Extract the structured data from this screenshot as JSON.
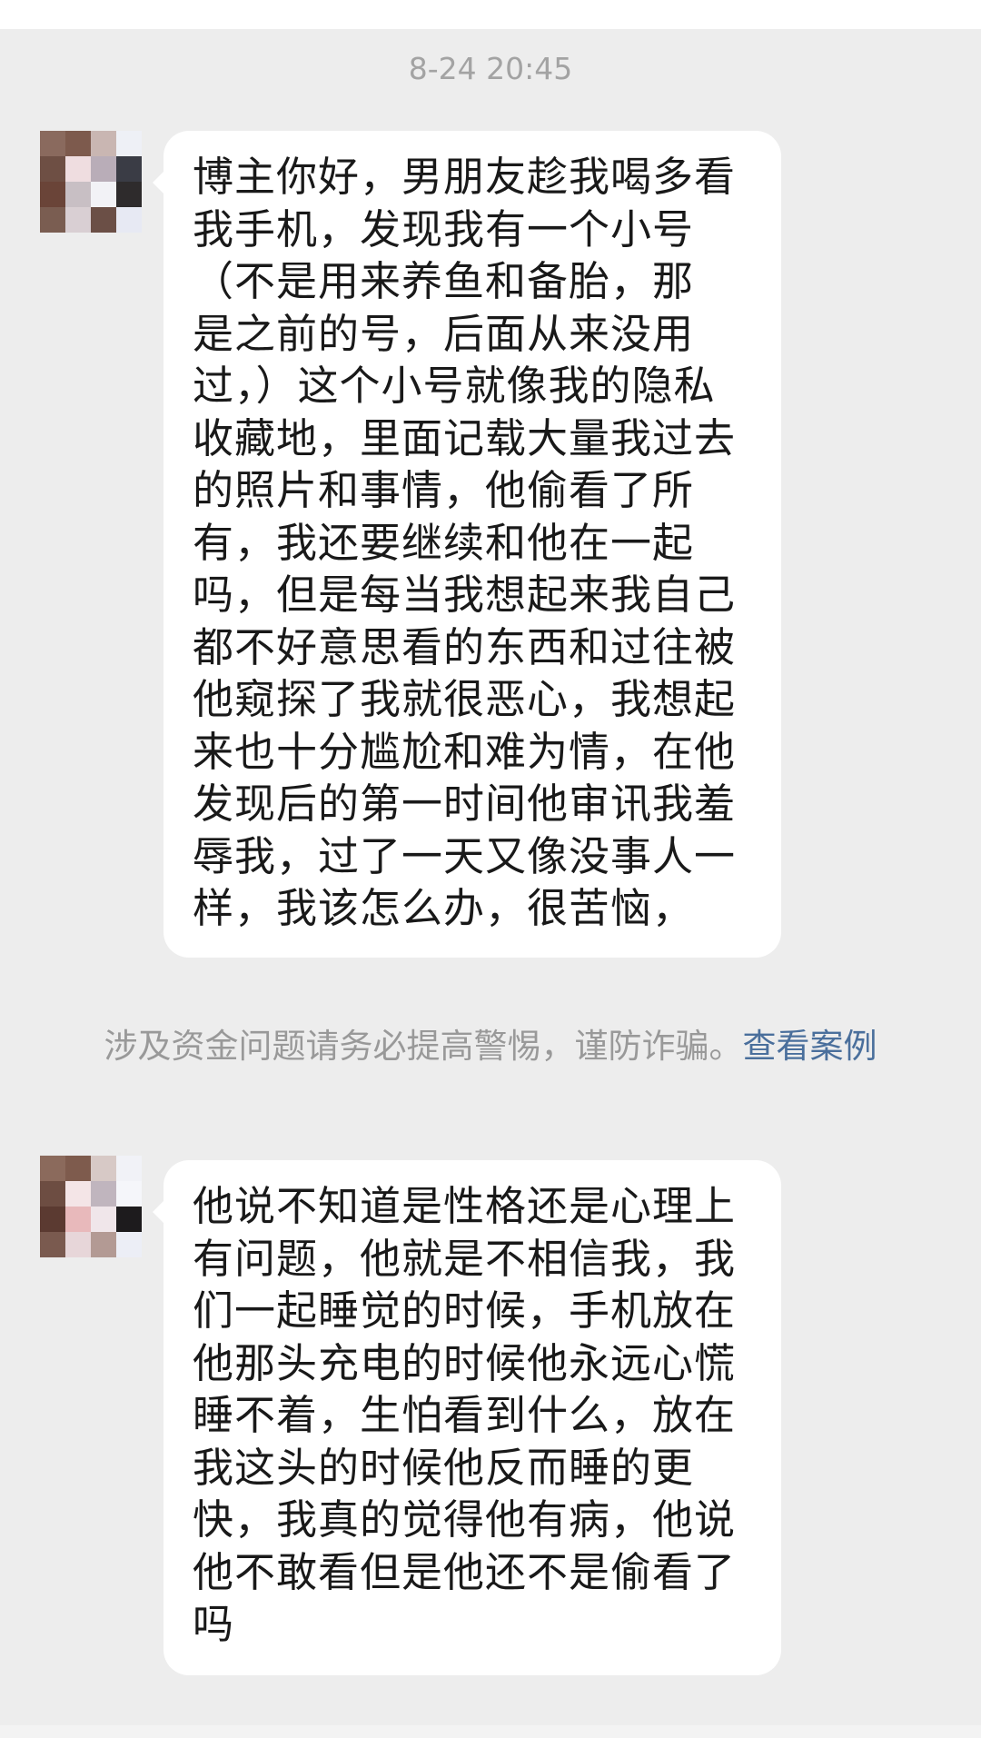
{
  "chat": {
    "timestamp": "8-24 20:45",
    "messages": [
      {
        "sender": "incoming",
        "text": "博主你好，男朋友趁我喝多看\n我手机，发现我有一个小号\n（不是用来养鱼和备胎，那\n是之前的号，后面从来没用\n过，）这个小号就像我的隐私\n收藏地，里面记载大量我过去\n的照片和事情，他偷看了所\n有，我还要继续和他在一起\n吗，但是每当我想起来我自己\n都不好意思看的东西和过往被\n他窥探了我就很恶心，我想起\n来也十分尴尬和难为情，在他\n发现后的第一时间他审讯我羞\n辱我，过了一天又像没事人一\n样，我该怎么办，很苦恼，"
      },
      {
        "sender": "incoming",
        "text": "他说不知道是性格还是心理上\n有问题，他就是不相信我，我\n们一起睡觉的时候，手机放在\n他那头充电的时候他永远心慌\n睡不着，生怕看到什么，放在\n我这头的时候他反而睡的更\n快，我真的觉得他有病，他说\n他不敢看但是他还不是偷看了\n吗"
      }
    ],
    "system_notice": {
      "text": "涉及资金问题请务必提高警惕，谨防诈骗。",
      "link_label": "查看案例"
    }
  },
  "avatars": [
    {
      "icon": "pixelated-avatar-icon",
      "pixels": [
        "#8a6a5e",
        "#7d5a4d",
        "#c9b6b2",
        "#eef0f6",
        "#6e4f44",
        "#efdde0",
        "#b9adb8",
        "#3a3c45",
        "#6a4438",
        "#c8bfc4",
        "#f2f2f6",
        "#2e2b2c",
        "#7a5d51",
        "#d9cfd3",
        "#6b4f46",
        "#e7e9f3"
      ]
    },
    {
      "icon": "pixelated-avatar-icon",
      "pixels": [
        "#8b6a5c",
        "#7e5b4d",
        "#d7c9c6",
        "#f1f2f7",
        "#6d4d42",
        "#f4e5e7",
        "#c0b5be",
        "#f5f6fa",
        "#5b3a31",
        "#e8b9bb",
        "#f0e6ea",
        "#1d1b1d",
        "#7a5a4f",
        "#e7d6d9",
        "#b39a94",
        "#eceef6"
      ]
    }
  ],
  "colors": {
    "background": "#ededed",
    "bubble": "#ffffff",
    "message_text": "#191919",
    "timestamp": "#a3a3a3",
    "notice_text": "#999999",
    "link": "#4a6f9c"
  }
}
